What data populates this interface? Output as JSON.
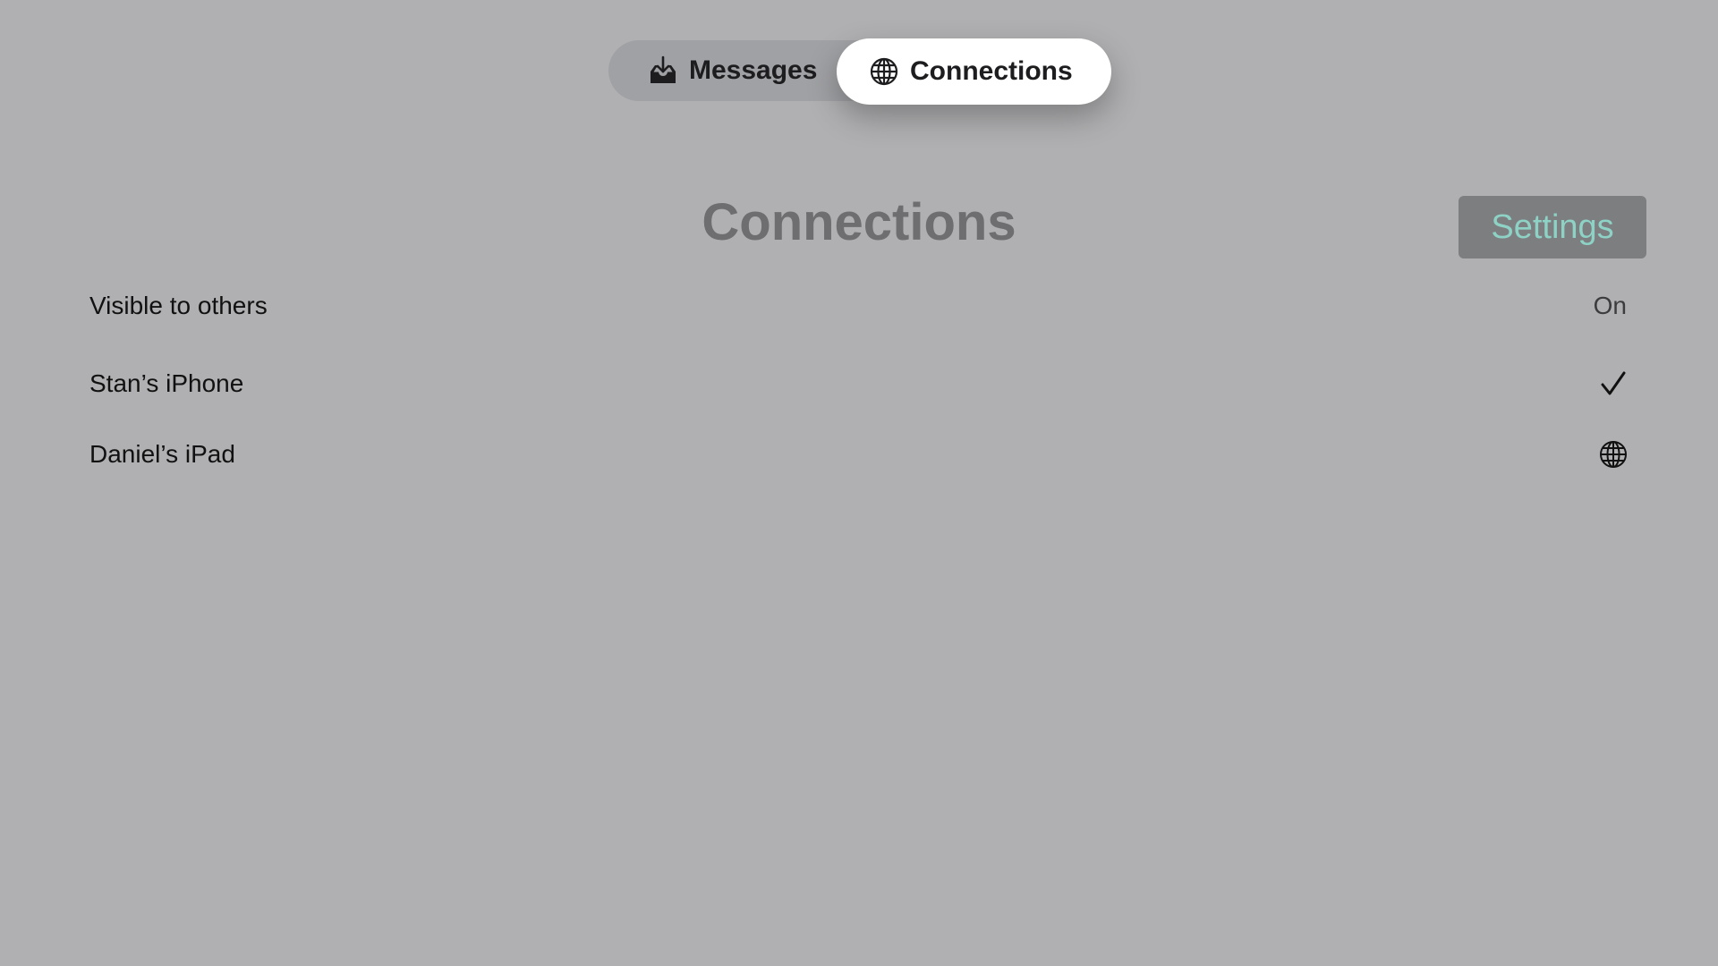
{
  "tabs": [
    {
      "label": "Messages",
      "icon": "tray-download-icon",
      "selected": false
    },
    {
      "label": "Connections",
      "icon": "globe-icon",
      "selected": true
    }
  ],
  "header": {
    "title": "Connections",
    "settings_label": "Settings"
  },
  "rows": [
    {
      "label": "Visible to others",
      "value": "On"
    },
    {
      "label": "Stan’s iPhone",
      "status_icon": "checkmark-icon"
    },
    {
      "label": "Daniel’s iPad",
      "status_icon": "globe-icon"
    }
  ],
  "colors": {
    "background": "#b0b0b2",
    "tabbar": "#a0a1a4",
    "selected_tab": "#ffffff",
    "title": "#6e6e70",
    "settings_button_bg": "#7d7e80",
    "settings_button_text": "#8ed2c6"
  }
}
